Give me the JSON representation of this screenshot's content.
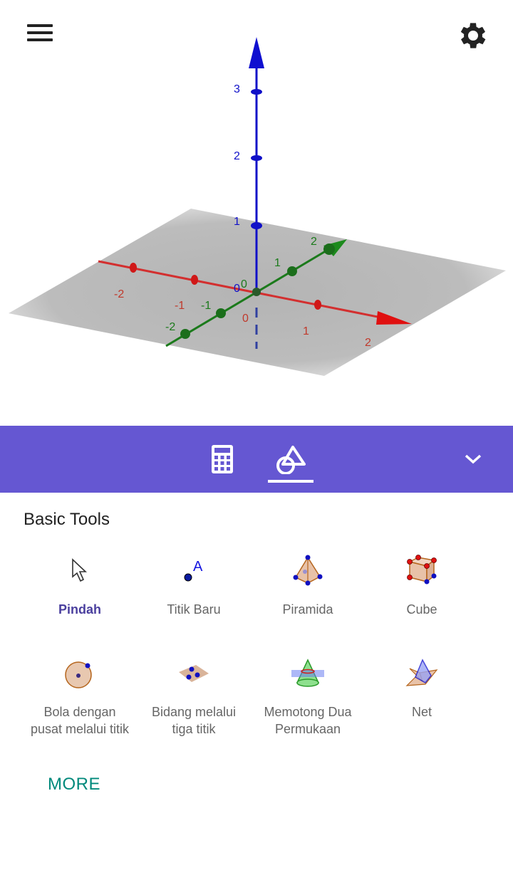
{
  "view3d": {
    "x_axis": {
      "color": "#d32f2f",
      "labels": [
        "-2",
        "-1",
        "0",
        "1",
        "2"
      ]
    },
    "y_axis": {
      "color": "#1b7a1b",
      "labels": [
        "-2",
        "-1",
        "0",
        "1",
        "2"
      ]
    },
    "z_axis": {
      "color": "#1010c8",
      "labels": [
        "0",
        "1",
        "2",
        "3"
      ]
    },
    "menu_icon": "hamburger-menu-icon",
    "settings_icon": "gear-icon"
  },
  "toolbar": {
    "color": "#6557d2",
    "tabs": [
      {
        "name": "algebra",
        "icon": "calculator-icon"
      },
      {
        "name": "tools",
        "icon": "shapes-icon",
        "active": true
      }
    ],
    "collapse_icon": "chevron-down-icon"
  },
  "panel": {
    "title": "Basic Tools",
    "tools": [
      {
        "label": "Pindah",
        "icon": "move-cursor-icon",
        "active": true
      },
      {
        "label": "Titik Baru",
        "icon": "point-icon"
      },
      {
        "label": "Piramida",
        "icon": "pyramid-icon"
      },
      {
        "label": "Cube",
        "icon": "cube-icon"
      },
      {
        "label": "Bola dengan pusat melalui titik",
        "line1": "Bola dengan",
        "line2": "pusat melalui titik",
        "icon": "sphere-icon"
      },
      {
        "label": "Bidang melalui tiga titik",
        "line1": "Bidang melalui",
        "line2": "tiga titik",
        "icon": "plane-three-points-icon"
      },
      {
        "label": "Memotong Dua Permukaan",
        "line1": "Memotong Dua",
        "line2": "Permukaan",
        "icon": "intersect-surfaces-icon"
      },
      {
        "label": "Net",
        "icon": "net-icon"
      }
    ],
    "more_label": "MORE"
  }
}
